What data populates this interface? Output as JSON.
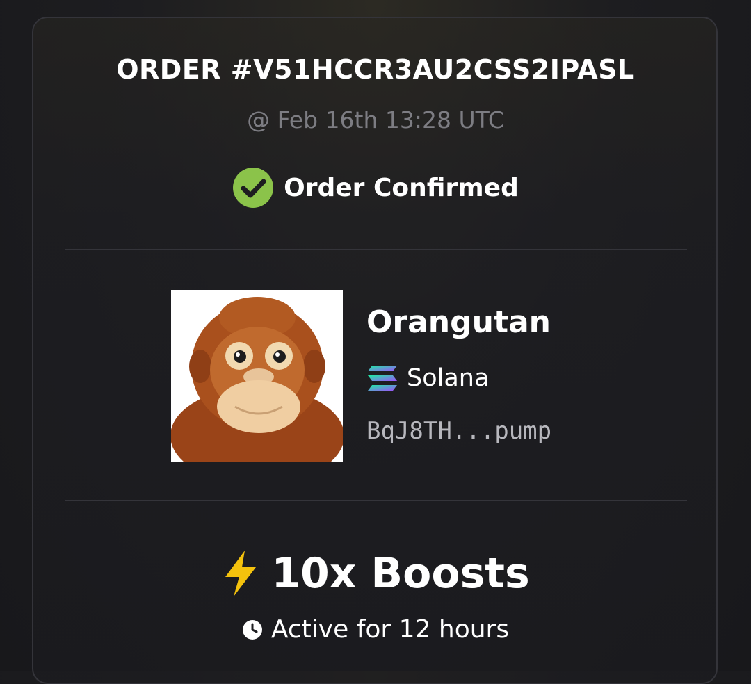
{
  "order": {
    "id_label": "ORDER #V51HCCR3AU2CSS2IPASL",
    "timestamp": "@ Feb 16th 13:28 UTC",
    "status": "Order Confirmed",
    "status_icon": "check-circle-icon",
    "status_color": "#8bc34a"
  },
  "token": {
    "name": "Orangutan",
    "image": "orangutan-plush-image",
    "chain": {
      "name": "Solana",
      "icon": "solana-logo-icon"
    },
    "address": "BqJ8TH...pump"
  },
  "boost": {
    "label": "10x Boosts",
    "icon": "lightning-bolt-icon",
    "icon_color": "#f4c20d",
    "duration": "Active for 12 hours",
    "duration_icon": "clock-icon"
  }
}
